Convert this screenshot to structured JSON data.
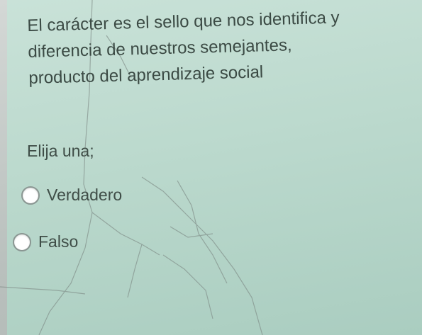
{
  "question": {
    "lines": [
      "El carácter es el sello que nos identifica y",
      "diferencia de nuestros semejantes,",
      "producto del aprendizaje social"
    ]
  },
  "prompt": "Elija una;",
  "options": [
    {
      "label": "Verdadero",
      "selected": false
    },
    {
      "label": "Falso",
      "selected": false
    }
  ],
  "colors": {
    "card_background": "#bbd9cd",
    "outer_background": "#bcc3c0",
    "text": "#3b4a44"
  }
}
